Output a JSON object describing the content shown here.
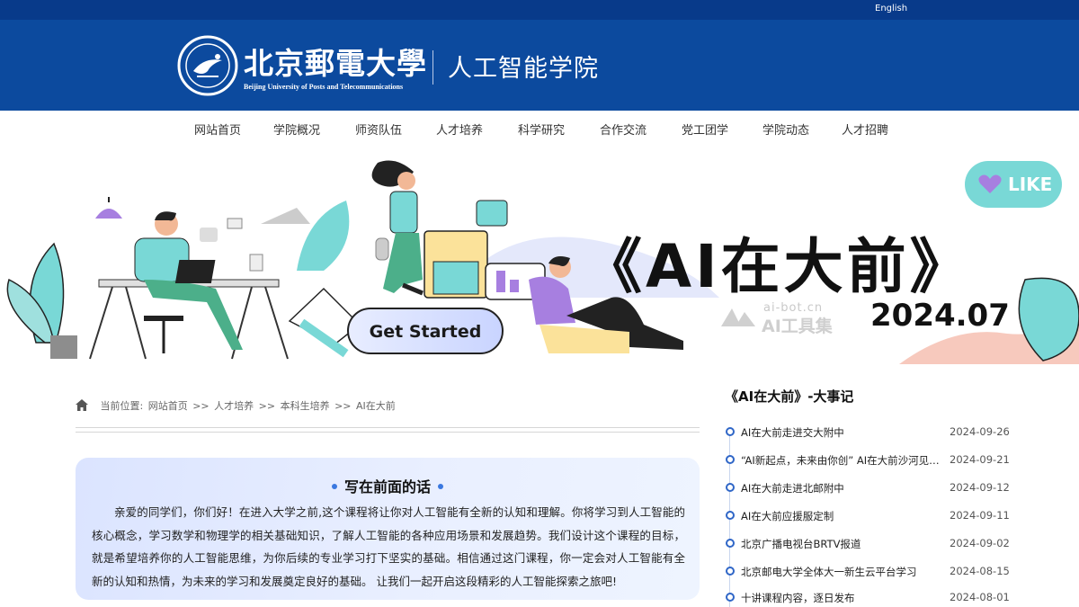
{
  "topbar": {
    "language_link": "English"
  },
  "header": {
    "university_name": "北京郵電大學",
    "university_name_en": "Beijing University of Posts and Telecommunications",
    "school_name": "人工智能学院"
  },
  "nav": {
    "items": [
      "网站首页",
      "学院概况",
      "师资队伍",
      "人才培养",
      "科学研究",
      "合作交流",
      "党工团学",
      "学院动态",
      "人才招聘"
    ]
  },
  "banner": {
    "title": "《AI在大前》",
    "date": "2024.07",
    "like_label": "LIKE",
    "cta_label": "Get Started",
    "watermark_url": "ai-bot.cn",
    "watermark_name": "AI工具集",
    "colors": {
      "teal": "#79d8d6",
      "purple": "#a77fe0",
      "dark": "#111111"
    }
  },
  "breadcrumb": {
    "prefix": "当前位置:",
    "items": [
      "网站首页",
      ">>",
      "人才培养",
      ">>",
      "本科生培养",
      ">>",
      "AI在大前"
    ]
  },
  "intro": {
    "title": "写在前面的话",
    "body": "亲爱的同学们，你们好！在进入大学之前,这个课程将让你对人工智能有全新的认知和理解。你将学习到人工智能的核心概念，学习数学和物理学的相关基础知识，了解人工智能的各种应用场景和发展趋势。我们设计这个课程的目标，就是希望培养你的人工智能思维，为你后续的专业学习打下坚实的基础。相信通过这门课程，你一定会对人工智能有全新的认知和热情，为未来的学习和发展奠定良好的基础。 让我们一起开启这段精彩的人工智能探索之旅吧!"
  },
  "sidebar": {
    "title": "《AI在大前》-大事记",
    "events": [
      {
        "title": "AI在大前走进交大附中",
        "date": "2024-09-26"
      },
      {
        "title": "“AI新起点，未来由你创” AI在大前沙河见面会",
        "date": "2024-09-21"
      },
      {
        "title": "AI在大前走进北邮附中",
        "date": "2024-09-12"
      },
      {
        "title": "AI在大前应援服定制",
        "date": "2024-09-11"
      },
      {
        "title": "北京广播电视台BRTV报道",
        "date": "2024-09-02"
      },
      {
        "title": "北京邮电大学全体大一新生云平台学习",
        "date": "2024-08-15"
      },
      {
        "title": "十讲课程内容，逐日发布",
        "date": "2024-08-01"
      }
    ]
  }
}
